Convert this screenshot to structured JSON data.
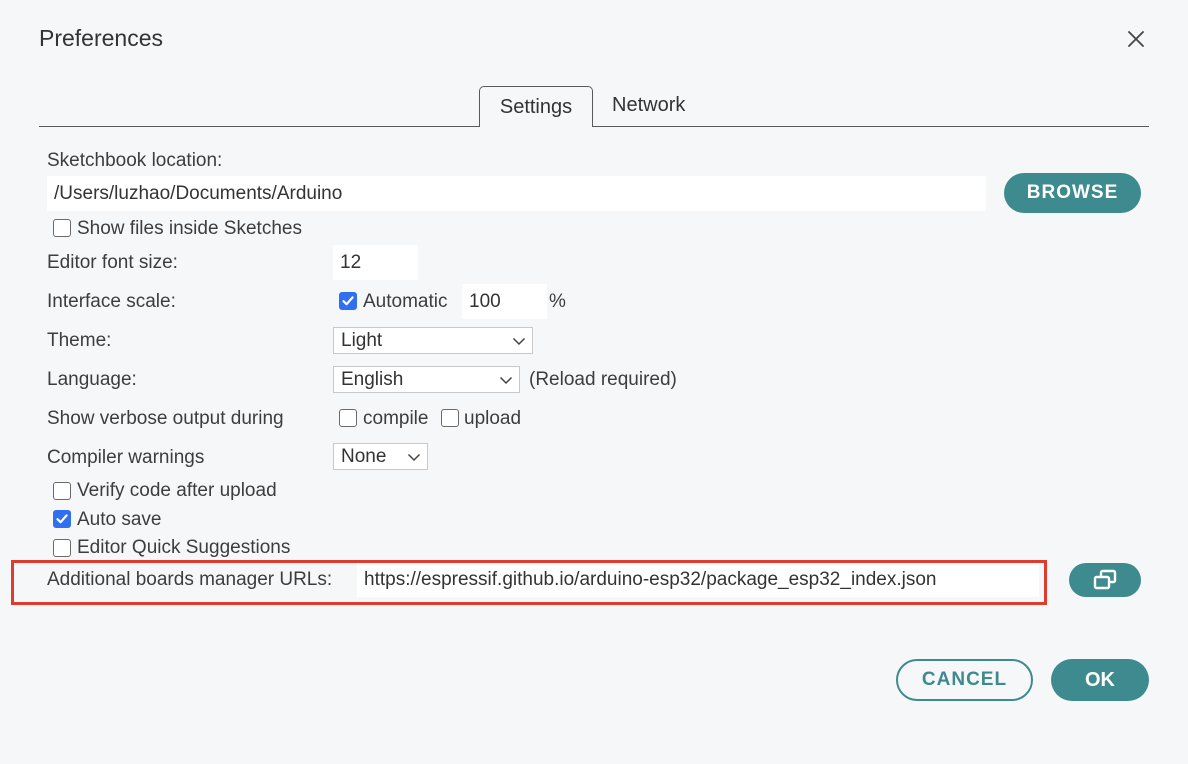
{
  "dialog": {
    "title": "Preferences"
  },
  "tabs": {
    "settings": "Settings",
    "network": "Network"
  },
  "sketchbook": {
    "label": "Sketchbook location:",
    "value": "/Users/luzhao/Documents/Arduino",
    "browse_label": "BROWSE",
    "show_files_label": "Show files inside Sketches",
    "show_files_checked": false
  },
  "font_size": {
    "label": "Editor font size:",
    "value": "12"
  },
  "scale": {
    "label": "Interface scale:",
    "automatic_label": "Automatic",
    "automatic_checked": true,
    "value": "100",
    "unit": "%"
  },
  "theme": {
    "label": "Theme:",
    "selected": "Light"
  },
  "language": {
    "label": "Language:",
    "selected": "English",
    "note": "(Reload required)"
  },
  "verbose": {
    "label": "Show verbose output during",
    "compile_label": "compile",
    "compile_checked": false,
    "upload_label": "upload",
    "upload_checked": false
  },
  "warnings": {
    "label": "Compiler warnings",
    "selected": "None"
  },
  "options": {
    "verify_label": "Verify code after upload",
    "verify_checked": false,
    "autosave_label": "Auto save",
    "autosave_checked": true,
    "quick_suggestions_label": "Editor Quick Suggestions",
    "quick_suggestions_checked": false
  },
  "boards_urls": {
    "label": "Additional boards manager URLs:",
    "value": "https://espressif.github.io/arduino-esp32/package_esp32_index.json"
  },
  "footer": {
    "cancel_label": "CANCEL",
    "ok_label": "OK"
  },
  "colors": {
    "accent": "#3d8b8f",
    "checkbox": "#2f6ff0",
    "highlight": "#e03c2d"
  }
}
